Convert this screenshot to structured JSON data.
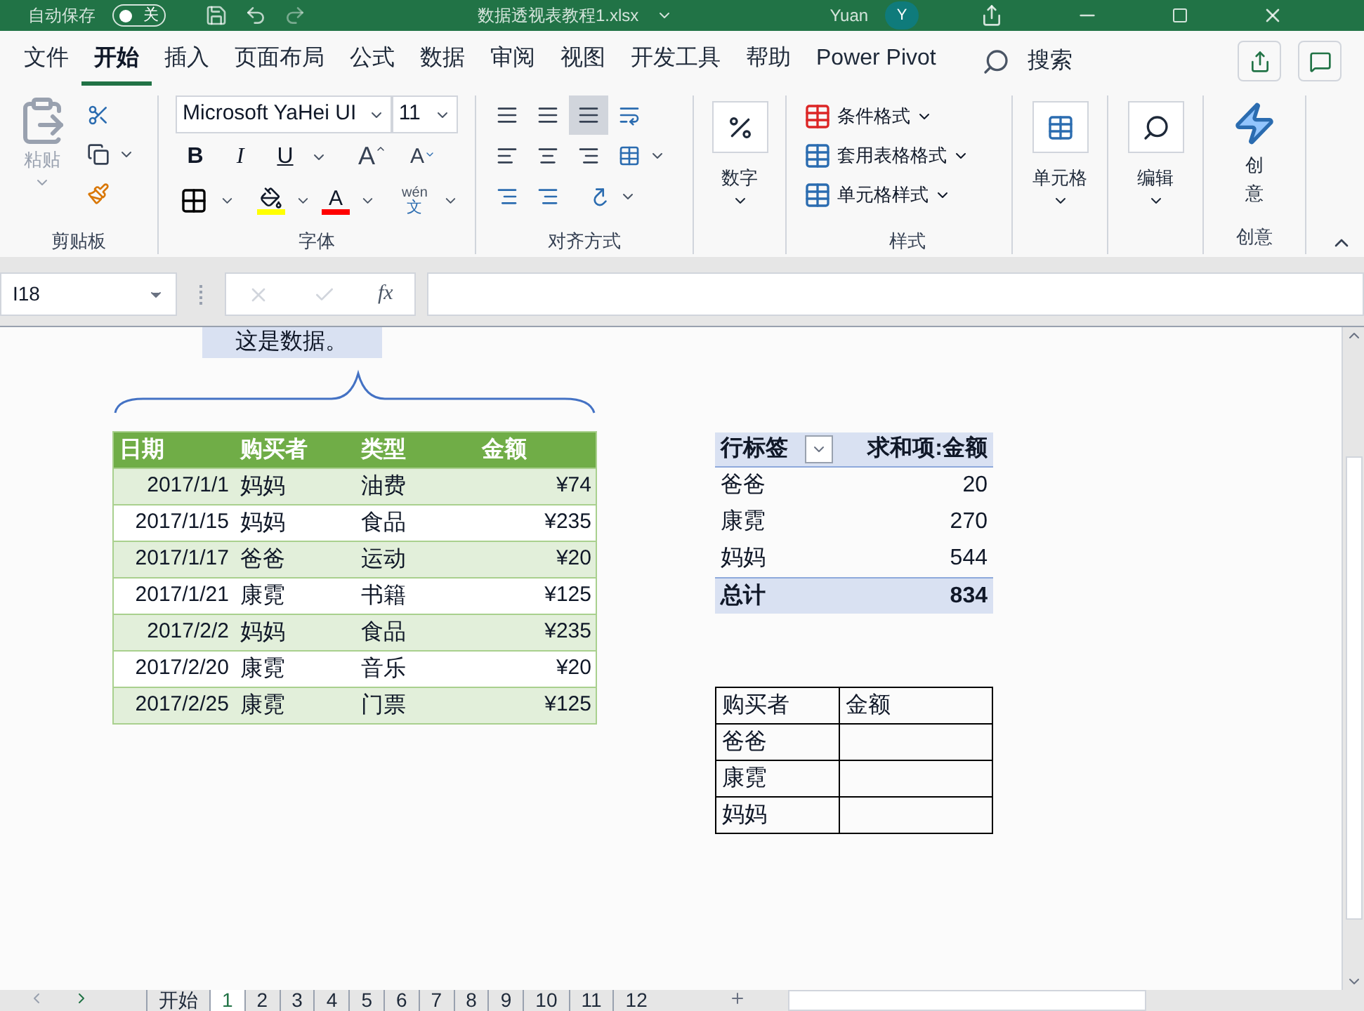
{
  "title_bar": {
    "autosave_label": "自动保存",
    "autosave_toggle": {
      "label": "关",
      "on": false
    },
    "file_name": "数据透视表教程1.xlsx",
    "user_name": "Yuan",
    "avatar_letter": "Y"
  },
  "menu_tabs": [
    {
      "label": "文件",
      "selected": false
    },
    {
      "label": "开始",
      "selected": true
    },
    {
      "label": "插入",
      "selected": false
    },
    {
      "label": "页面布局",
      "selected": false
    },
    {
      "label": "公式",
      "selected": false
    },
    {
      "label": "数据",
      "selected": false
    },
    {
      "label": "审阅",
      "selected": false
    },
    {
      "label": "视图",
      "selected": false
    },
    {
      "label": "开发工具",
      "selected": false
    },
    {
      "label": "帮助",
      "selected": false
    },
    {
      "label": "Power Pivot",
      "selected": false
    }
  ],
  "search_label": "搜索",
  "ribbon": {
    "clipboard": {
      "paste": "粘贴",
      "label": "剪贴板"
    },
    "font": {
      "font_name": "Microsoft YaHei UI",
      "font_size": "11",
      "bold": "B",
      "italic": "I",
      "underline": "U",
      "grow_font": "A",
      "shrink_font": "A",
      "font_color": "A",
      "phonetic_top": "wén",
      "phonetic_bottom": "文",
      "label": "字体"
    },
    "alignment": {
      "label": "对齐方式"
    },
    "number": {
      "button": "数字"
    },
    "styles": {
      "items": [
        "条件格式",
        "套用表格格式",
        "单元格样式"
      ],
      "label": "样式"
    },
    "cells": {
      "button": "单元格"
    },
    "editing": {
      "button": "编辑"
    },
    "ideas": {
      "button": "创意",
      "label": "创意"
    }
  },
  "formula_bar": {
    "name_box": "I18",
    "fx": "fx"
  },
  "sheet": {
    "callout": "这是数据。",
    "data_table": {
      "columns": [
        "日期",
        "购买者",
        "类型",
        "金额"
      ],
      "rows": [
        [
          "2017/1/1",
          "妈妈",
          "油费",
          "¥74"
        ],
        [
          "2017/1/15",
          "妈妈",
          "食品",
          "¥235"
        ],
        [
          "2017/1/17",
          "爸爸",
          "运动",
          "¥20"
        ],
        [
          "2017/1/21",
          "康霓",
          "书籍",
          "¥125"
        ],
        [
          "2017/2/2",
          "妈妈",
          "食品",
          "¥235"
        ],
        [
          "2017/2/20",
          "康霓",
          "音乐",
          "¥20"
        ],
        [
          "2017/2/25",
          "康霓",
          "门票",
          "¥125"
        ]
      ]
    },
    "pivot_table": {
      "columns": [
        "行标签",
        "求和项:金额"
      ],
      "rows": [
        [
          "爸爸",
          "20"
        ],
        [
          "康霓",
          "270"
        ],
        [
          "妈妈",
          "544"
        ]
      ],
      "total": [
        "总计",
        "834"
      ]
    },
    "summary_table": {
      "columns": [
        "购买者",
        "金额"
      ],
      "rows": [
        "爸爸",
        "康霓",
        "妈妈"
      ]
    }
  },
  "sheet_tabs": [
    {
      "label": "开始",
      "selected": false
    },
    {
      "label": "1",
      "selected": true
    },
    {
      "label": "2",
      "selected": false
    },
    {
      "label": "3",
      "selected": false
    },
    {
      "label": "4",
      "selected": false
    },
    {
      "label": "5",
      "selected": false
    },
    {
      "label": "6",
      "selected": false
    },
    {
      "label": "7",
      "selected": false
    },
    {
      "label": "8",
      "selected": false
    },
    {
      "label": "9",
      "selected": false
    },
    {
      "label": "10",
      "selected": false
    },
    {
      "label": "11",
      "selected": false
    },
    {
      "label": "12",
      "selected": false
    }
  ]
}
